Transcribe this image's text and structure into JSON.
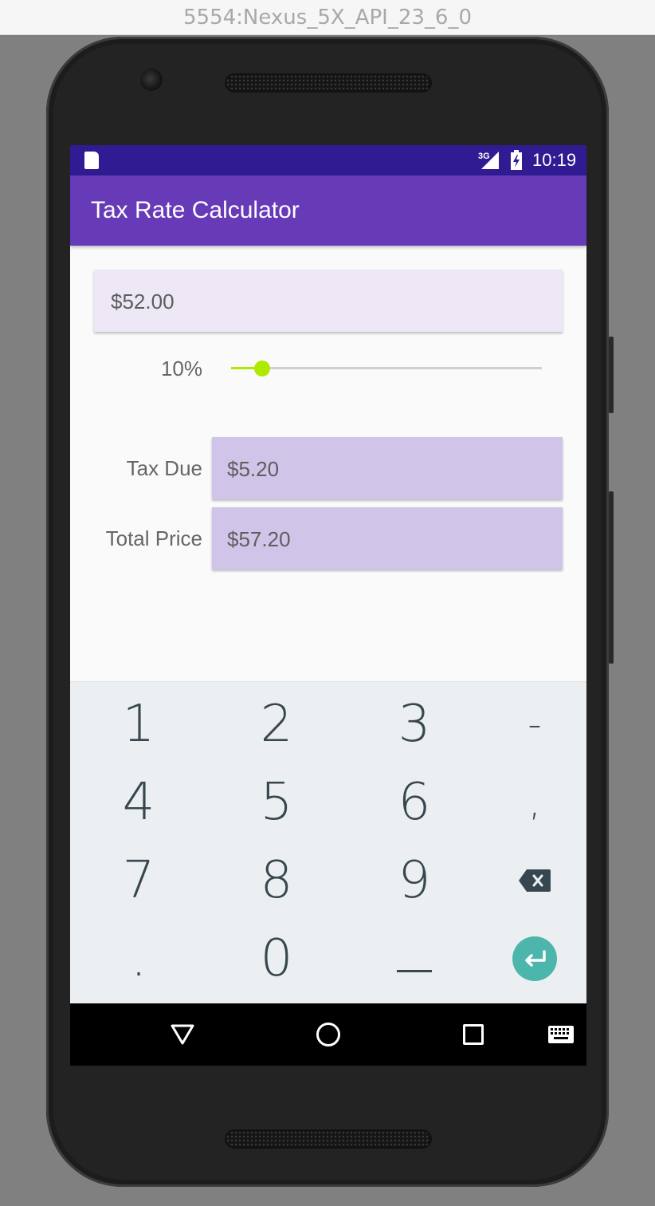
{
  "window": {
    "title": "5554:Nexus_5X_API_23_6_0"
  },
  "statusbar": {
    "network": "3G",
    "time": "10:19"
  },
  "app": {
    "title": "Tax Rate Calculator"
  },
  "form": {
    "price_value": "$52.00",
    "rate_label": "10%",
    "rate_slider_fraction": 0.1,
    "tax_due_label": "Tax Due",
    "tax_due_value": "$5.20",
    "total_label": "Total Price",
    "total_value": "$57.20"
  },
  "keyboard": {
    "keys": [
      [
        "1",
        "2",
        "3",
        "-"
      ],
      [
        "4",
        "5",
        "6",
        ","
      ],
      [
        "7",
        "8",
        "9",
        "backspace-icon"
      ],
      [
        ".",
        "0",
        "space-key",
        "enter-icon"
      ]
    ],
    "accent": "#4db6ac"
  },
  "colors": {
    "primary": "#673ab7",
    "primary_dark": "#311b92",
    "accent": "#aeea00",
    "input_bg": "#ede7f6",
    "output_bg": "#d1c4e9"
  }
}
